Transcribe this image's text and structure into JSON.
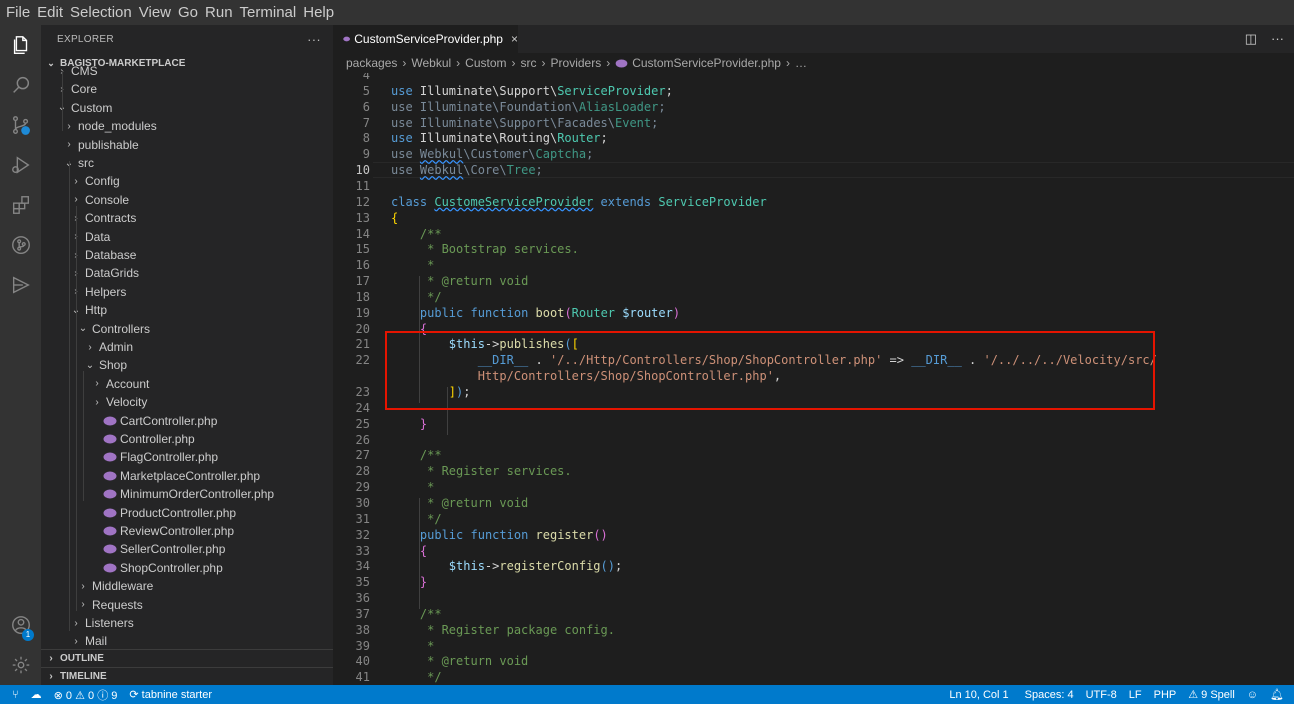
{
  "menu": [
    "File",
    "Edit",
    "Selection",
    "View",
    "Go",
    "Run",
    "Terminal",
    "Help"
  ],
  "activity_icons": [
    "files-icon",
    "search-icon",
    "source-control-icon",
    "run-debug-icon",
    "extensions-icon",
    "git-graph-icon",
    "remote-explorer-icon",
    "account-icon",
    "gear-icon"
  ],
  "account_badge": "1",
  "sidebar": {
    "title": "EXPLORER",
    "more": "···",
    "root": "BAGISTO-MARKETPLACE",
    "outline": "OUTLINE",
    "timeline": "TIMELINE"
  },
  "tree": [
    {
      "label": "CMS",
      "depth": 1,
      "kind": "folder",
      "open": false
    },
    {
      "label": "Core",
      "depth": 1,
      "kind": "folder",
      "open": false
    },
    {
      "label": "Custom",
      "depth": 1,
      "kind": "folder",
      "open": true
    },
    {
      "label": "node_modules",
      "depth": 2,
      "kind": "folder",
      "open": false
    },
    {
      "label": "publishable",
      "depth": 2,
      "kind": "folder",
      "open": false
    },
    {
      "label": "src",
      "depth": 2,
      "kind": "folder",
      "open": true
    },
    {
      "label": "Config",
      "depth": 3,
      "kind": "folder",
      "open": false
    },
    {
      "label": "Console",
      "depth": 3,
      "kind": "folder",
      "open": false
    },
    {
      "label": "Contracts",
      "depth": 3,
      "kind": "folder",
      "open": false
    },
    {
      "label": "Data",
      "depth": 3,
      "kind": "folder",
      "open": false
    },
    {
      "label": "Database",
      "depth": 3,
      "kind": "folder",
      "open": false
    },
    {
      "label": "DataGrids",
      "depth": 3,
      "kind": "folder",
      "open": false
    },
    {
      "label": "Helpers",
      "depth": 3,
      "kind": "folder",
      "open": false
    },
    {
      "label": "Http",
      "depth": 3,
      "kind": "folder",
      "open": true
    },
    {
      "label": "Controllers",
      "depth": 4,
      "kind": "folder",
      "open": true
    },
    {
      "label": "Admin",
      "depth": 5,
      "kind": "folder",
      "open": false
    },
    {
      "label": "Shop",
      "depth": 5,
      "kind": "folder",
      "open": true
    },
    {
      "label": "Account",
      "depth": 6,
      "kind": "folder",
      "open": false
    },
    {
      "label": "Velocity",
      "depth": 6,
      "kind": "folder",
      "open": false
    },
    {
      "label": "CartController.php",
      "depth": 6,
      "kind": "file"
    },
    {
      "label": "Controller.php",
      "depth": 6,
      "kind": "file"
    },
    {
      "label": "FlagController.php",
      "depth": 6,
      "kind": "file"
    },
    {
      "label": "MarketplaceController.php",
      "depth": 6,
      "kind": "file"
    },
    {
      "label": "MinimumOrderController.php",
      "depth": 6,
      "kind": "file"
    },
    {
      "label": "ProductController.php",
      "depth": 6,
      "kind": "file"
    },
    {
      "label": "ReviewController.php",
      "depth": 6,
      "kind": "file"
    },
    {
      "label": "SellerController.php",
      "depth": 6,
      "kind": "file"
    },
    {
      "label": "ShopController.php",
      "depth": 6,
      "kind": "file"
    },
    {
      "label": "Middleware",
      "depth": 4,
      "kind": "folder",
      "open": false
    },
    {
      "label": "Requests",
      "depth": 4,
      "kind": "folder",
      "open": false
    },
    {
      "label": "Listeners",
      "depth": 3,
      "kind": "folder",
      "open": false
    },
    {
      "label": "Mail",
      "depth": 3,
      "kind": "folder",
      "open": false
    }
  ],
  "tab": {
    "label": "CustomServiceProvider.php",
    "close": "×"
  },
  "tab_actions": [
    "◫",
    "···"
  ],
  "breadcrumbs": [
    "packages",
    "Webkul",
    "Custom",
    "src",
    "Providers",
    "CustomServiceProvider.php",
    "…"
  ],
  "code": [
    {
      "n": "4",
      "cur": false,
      "html": ""
    },
    {
      "n": "5",
      "html": "<span class='k'>use</span> Illuminate\\Support\\<span class='t'>ServiceProvider</span>;"
    },
    {
      "n": "6",
      "html": "<span class='dim'>use</span> <span class='dim'>Illuminate\\Foundation\\</span><span class='t' style='opacity:.7'>AliasLoader</span><span class='dim'>;</span>"
    },
    {
      "n": "7",
      "html": "<span class='dim'>use</span> <span class='dim'>Illuminate\\Support\\Facades\\</span><span class='t' style='opacity:.7'>Event</span><span class='dim'>;</span>"
    },
    {
      "n": "8",
      "html": "<span class='k'>use</span> Illuminate\\Routing\\<span class='t'>Router</span>;"
    },
    {
      "n": "9",
      "html": "<span class='dim'>use</span> <span class='dim sq'>Webkul</span><span class='dim'>\\Customer\\</span><span class='t' style='opacity:.7'>Captcha</span><span class='dim'>;</span>"
    },
    {
      "n": "10",
      "cur": true,
      "html": "<span class='dim'>use</span> <span class='dim sq'>Webkul</span><span class='dim'>\\Core\\</span><span class='t' style='opacity:.7'>Tree</span><span class='dim'>;</span>"
    },
    {
      "n": "11",
      "html": ""
    },
    {
      "n": "12",
      "html": "<span class='k'>class</span> <span class='t sq'>CustomeServiceProvider</span> <span class='k'>extends</span> <span class='t'>ServiceProvider</span>"
    },
    {
      "n": "13",
      "html": "<span class='p'>{</span>"
    },
    {
      "n": "14",
      "html": "    <span class='c'>/**</span>"
    },
    {
      "n": "15",
      "html": "    <span class='c'> * Bootstrap services.</span>"
    },
    {
      "n": "16",
      "html": "    <span class='c'> *</span>"
    },
    {
      "n": "17",
      "html": "    <span class='c'> * </span><span class='c'>@return</span><span class='c'> void</span>"
    },
    {
      "n": "18",
      "html": "    <span class='c'> */</span>"
    },
    {
      "n": "19",
      "html": "    <span class='k'>public</span> <span class='k'>function</span> <span class='f'>boot</span><span class='b'>(</span><span class='t'>Router</span> <span class='v'>$router</span><span class='b'>)</span>"
    },
    {
      "n": "20",
      "html": "    <span class='b'>{</span>"
    },
    {
      "n": "21",
      "html": "        <span class='v'>$this</span>-><span class='f'>publishes</span><span class='k'>(</span><span class='p'>[</span>"
    },
    {
      "n": "22",
      "html": "            <span class='k'>__DIR__</span> . <span class='s'>'/../Http/Controllers/Shop/ShopController.php'</span> => <span class='k'>__DIR__</span> . <span class='s'>'/../../../Velocity/src/</span>"
    },
    {
      "n": "",
      "html": "            <span class='s'>Http/Controllers/Shop/ShopController.php'</span>,"
    },
    {
      "n": "23",
      "html": "        <span class='p'>]</span><span class='k'>)</span>;"
    },
    {
      "n": "24",
      "html": ""
    },
    {
      "n": "25",
      "html": "    <span class='b'>}</span>"
    },
    {
      "n": "26",
      "html": ""
    },
    {
      "n": "27",
      "html": "    <span class='c'>/**</span>"
    },
    {
      "n": "28",
      "html": "    <span class='c'> * Register services.</span>"
    },
    {
      "n": "29",
      "html": "    <span class='c'> *</span>"
    },
    {
      "n": "30",
      "html": "    <span class='c'> * @return void</span>"
    },
    {
      "n": "31",
      "html": "    <span class='c'> */</span>"
    },
    {
      "n": "32",
      "html": "    <span class='k'>public</span> <span class='k'>function</span> <span class='f'>register</span><span class='b'>()</span>"
    },
    {
      "n": "33",
      "html": "    <span class='b'>{</span>"
    },
    {
      "n": "34",
      "html": "        <span class='v'>$this</span>-><span class='f'>registerConfig</span><span class='k'>()</span>;"
    },
    {
      "n": "35",
      "html": "    <span class='b'>}</span>"
    },
    {
      "n": "36",
      "html": ""
    },
    {
      "n": "37",
      "html": "    <span class='c'>/**</span>"
    },
    {
      "n": "38",
      "html": "    <span class='c'> * Register package config.</span>"
    },
    {
      "n": "39",
      "html": "    <span class='c'> *</span>"
    },
    {
      "n": "40",
      "html": "    <span class='c'> * @return void</span>"
    },
    {
      "n": "41",
      "html": "    <span class='c'> */</span>"
    }
  ],
  "status": {
    "errors": "0",
    "warnings": "0",
    "info": "9",
    "tabnine": "tabnine starter",
    "position": "Ln 10, Col 1",
    "spaces": "Spaces: 4",
    "encoding": "UTF-8",
    "eol": "LF",
    "language": "PHP",
    "spell": "9 Spell"
  },
  "colors": {
    "accent": "#007acc",
    "highlight_box": "#e51400",
    "activity_bg": "#333333",
    "sidebar_bg": "#252526",
    "editor_bg": "#1e1e1e"
  }
}
